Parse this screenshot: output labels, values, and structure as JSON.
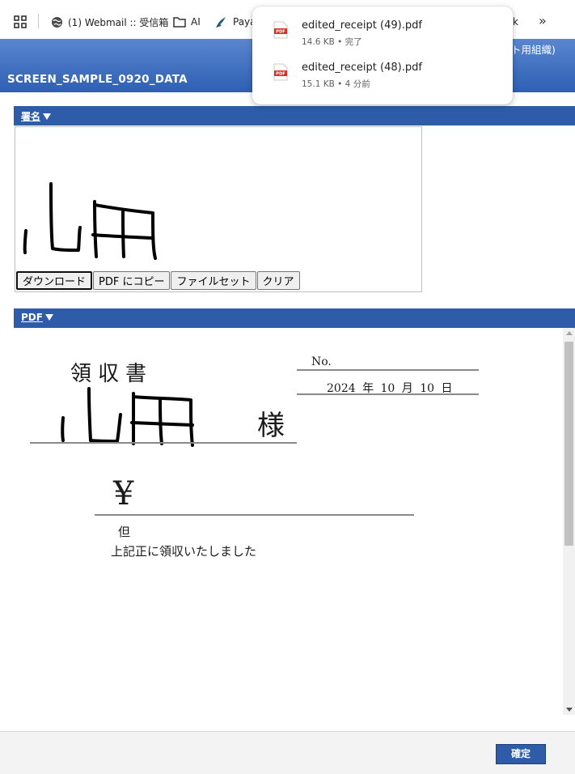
{
  "bookmarks": {
    "items": [
      {
        "label": "(1) Webmail :: 受信箱",
        "icon": "globe-icon"
      },
      {
        "label": "AI",
        "icon": "folder-icon"
      },
      {
        "label": "Paya",
        "icon": "bird-icon"
      },
      {
        "label": "k",
        "icon": ""
      }
    ],
    "more": "»"
  },
  "header": {
    "title": "SCREEN_SAMPLE_0920_DATA",
    "org_label": "ト用組織)"
  },
  "signature_section": {
    "label": "署名",
    "buttons": [
      "ダウンロード",
      "PDF にコピー",
      "ファイルセット",
      "クリア"
    ]
  },
  "pdf_section": {
    "label": "PDF"
  },
  "receipt": {
    "title": "領収書",
    "no_label": "No.",
    "date": "2024 年 10 月 10 日",
    "honorific": "様",
    "yen": "¥",
    "tadashi": "但",
    "received_text": "上記正に領収いたしました"
  },
  "footer": {
    "confirm_label": "確定"
  },
  "downloads": [
    {
      "name": "edited_receipt (49).pdf",
      "meta": "14.6 KB • 完了"
    },
    {
      "name": "edited_receipt (48).pdf",
      "meta": "15.1 KB • 4 分前"
    }
  ],
  "colors": {
    "brand_blue": "#2e5ca9",
    "header_gradient_top": "#5a86d0",
    "pdf_icon_red": "#d93025"
  }
}
